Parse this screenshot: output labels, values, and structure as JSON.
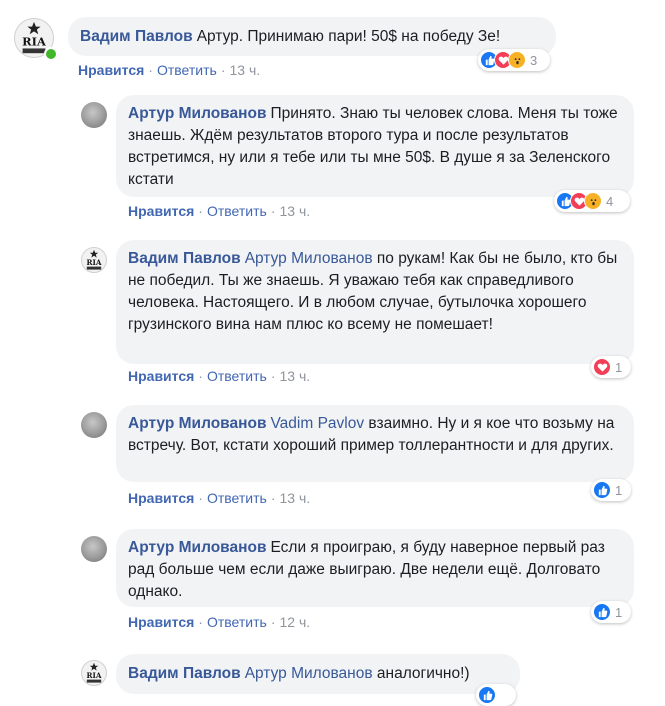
{
  "colors": {
    "name_link": "#385898",
    "action_link": "#4267b2",
    "bubble_bg": "#f2f3f5",
    "meta_gray": "#90949c",
    "like_blue": "#1877f2",
    "love_red": "#f33e58",
    "wow_yellow": "#f7b125",
    "online_green": "#42b72a"
  },
  "actions": {
    "like": "Нравится",
    "reply": "Ответить",
    "sep": "·"
  },
  "comments": [
    {
      "author": "Вадим Павлов",
      "mention": "",
      "text": "Артур. Принимаю пари! 50$ на победу Зе!",
      "time": "13 ч.",
      "reactions": [
        "like-icon",
        "love-icon",
        "wow-icon"
      ],
      "reaction_count": "3",
      "avatar": "ria-logo",
      "online": true
    },
    {
      "author": "Артур Милованов",
      "mention": "",
      "text": "Принято. Знаю ты человек слова. Меня ты тоже знаешь. Ждём результатов второго тура и после результатов встретимся, ну или я тебе или ты мне 50$. В душе я за Зеленского кстати",
      "time": "13 ч.",
      "reactions": [
        "like-icon",
        "love-icon",
        "wow-icon"
      ],
      "reaction_count": "4",
      "avatar": "gray"
    },
    {
      "author": "Вадим Павлов",
      "mention": "Артур Милованов",
      "text": "по рукам! Как бы не было, кто бы не победил. Ты же знаешь. Я уважаю тебя как справедливого человека. Настоящего. И в любом случае, бутылочка хорошего грузинского вина нам плюс ко всему не помешает!",
      "time": "13 ч.",
      "reactions": [
        "love-icon"
      ],
      "reaction_count": "1",
      "avatar": "ria-logo"
    },
    {
      "author": "Артур Милованов",
      "mention": "Vadim Pavlov",
      "text": "взаимно. Ну и я кое что возьму на встречу. Вот, кстати хороший пример толлерантности и для других.",
      "time": "13 ч.",
      "reactions": [
        "like-icon"
      ],
      "reaction_count": "1",
      "avatar": "gray"
    },
    {
      "author": "Артур Милованов",
      "mention": "",
      "text": "Если я проиграю, я буду наверное первый раз рад больше чем если даже выиграю. Две недели ещё. Долговато однако.",
      "time": "12 ч.",
      "reactions": [
        "like-icon"
      ],
      "reaction_count": "1",
      "avatar": "gray"
    },
    {
      "author": "Вадим Павлов",
      "mention": "Артур Милованов",
      "text": "аналогично!)",
      "time": "",
      "reactions": [
        "like-icon"
      ],
      "reaction_count": "",
      "avatar": "ria-logo"
    }
  ],
  "logo_text": "RIA"
}
